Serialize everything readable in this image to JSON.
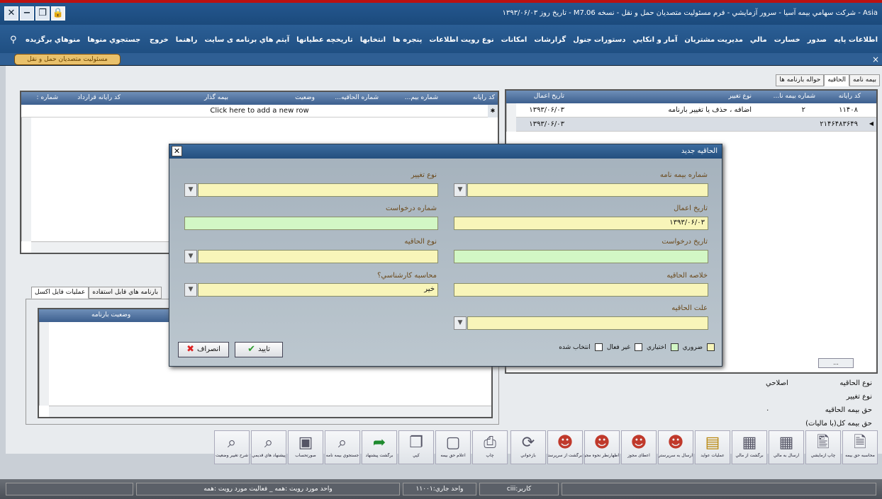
{
  "window": {
    "title": "Asia - شرکت سهامي بيمه آسيا - سرور آزمايشي - فرم مسئوليت متصديان حمل و نقل - نسخه M7.06 - تاريخ روز ۱۳۹۳/۰۶/۰۳"
  },
  "menu": {
    "main": [
      "اطلاعات پايه",
      "صدور",
      "خسارت",
      "مالي",
      "مديريت مشتريان",
      "آمار و انكايي",
      "دستورات جنول",
      "گزارشات",
      "امكانات",
      "نوع رويت اطلاعات",
      "پنجره ها",
      "انتخابها",
      "تاريخچه عطيانها",
      "آيتم هاي برنامه ی سایت",
      "راهنما",
      "خروج"
    ],
    "fav": "منوهاي برگزيده",
    "search": "جستجوي منوها"
  },
  "doc_tab": "مسئوليت متصديان حمل و نقل",
  "tabs": {
    "insurance": "بيمه نامه",
    "appendix": "الحاقيه",
    "waybill": "حواله بارنامه ها"
  },
  "left_grid": {
    "headers": [
      "كد رايانه",
      "شماره بيم...",
      "شماره الحاقيه...",
      "وضعيت",
      "بيمه گذار",
      "كد رايانه قرارداد",
      "شماره :"
    ],
    "add_row": "Click here to add a new row"
  },
  "right_grid": {
    "headers": [
      "كد رايانه",
      "شماره بيمه نا...",
      "نوع تغيير",
      "تاريخ اعمال"
    ],
    "rows": [
      {
        "code": "۱۱۴۰۸",
        "num": "۲",
        "type": "اضافه ، حذف يا تغيير بارنامه",
        "date": "۱۳۹۳/۰۶/۰۳"
      },
      {
        "code": "۲۱۴۶۴۸۳۶۴۹",
        "num": "",
        "type": "",
        "date": "۱۳۹۳/۰۶/۰۳"
      }
    ]
  },
  "lower_tabs": {
    "excel": "عمليات فايل اكسل",
    "usable": "بارنامه هاي قابل استفاده"
  },
  "lower_grid": {
    "header": "وضعيت بارنامه"
  },
  "dialog": {
    "title": "الحاقيه جديد",
    "labels": {
      "policy_no": "شماره بيمه نامه",
      "change_type": "نوع تغيير",
      "apply_date": "تاريخ اعمال",
      "request_no": "شماره درخواست",
      "request_date": "تاريخ درخواست",
      "appendix_type": "نوع الحاقيه",
      "summary": "خلاصه الحاقيه",
      "expert_calc": "محاسبه كارشناسي؟",
      "reason": "علت الحاقيه"
    },
    "values": {
      "apply_date": "۱۳۹۳/۰۶/۰۳",
      "expert_calc": "خير"
    },
    "legend": [
      "ضروري",
      "اختياري",
      "غير فعال",
      "انتخاب شده"
    ],
    "ok": "تاييد",
    "cancel": "انصراف"
  },
  "info": [
    {
      "label": "نوع الحاقيه",
      "value": "اصلاحي"
    },
    {
      "label": "نوع تغيير",
      "value": ""
    },
    {
      "label": "حق بيمه الحاقيه",
      "value": "۰"
    },
    {
      "label": "حق بيمه كل(با ماليات)",
      "value": ""
    }
  ],
  "toolbar": [
    {
      "icon": "doc-edit-icon",
      "label": "محاسبه حق بيمه"
    },
    {
      "icon": "doc-print-icon",
      "label": "چاپ آزمايشي"
    },
    {
      "icon": "box-icon",
      "label": "ارسال به مالي"
    },
    {
      "icon": "box-back-icon",
      "label": "برگشت از مالي"
    },
    {
      "icon": "money-icon",
      "label": "عمليات عوايد"
    },
    {
      "icon": "user-send-icon",
      "label": "ارسال به سرپرستي"
    },
    {
      "icon": "user-check-icon",
      "label": "اعطای مجوز"
    },
    {
      "icon": "user-view-icon",
      "label": "اظهارنظر نحوه مجوز"
    },
    {
      "icon": "user-back-icon",
      "label": "برگشت از سرپرستي"
    },
    {
      "icon": "refresh-icon",
      "label": "بازخواني"
    },
    {
      "icon": "printer-icon",
      "label": "چاپ"
    },
    {
      "icon": "clear-icon",
      "label": "اعلام حق بيمه"
    },
    {
      "icon": "copy-icon",
      "label": "كپي"
    },
    {
      "icon": "arrow-icon",
      "label": "برگشت پيشنهاد"
    },
    {
      "icon": "search-doc-icon",
      "label": "جستجوي بيمه نامه"
    },
    {
      "icon": "calc-icon",
      "label": "صورتحساب"
    },
    {
      "icon": "search-old-icon",
      "label": "پيشنهاد هاي قديمي"
    },
    {
      "icon": "history-icon",
      "label": "شرح تغيير وضعيت"
    }
  ],
  "status": {
    "user": "كاربر:ciii",
    "unit": "واحد جاري:۱۱۰۰۱",
    "seen_unit": "واحد مورد رويت :همه _ فعاليت مورد رويت :همه"
  }
}
